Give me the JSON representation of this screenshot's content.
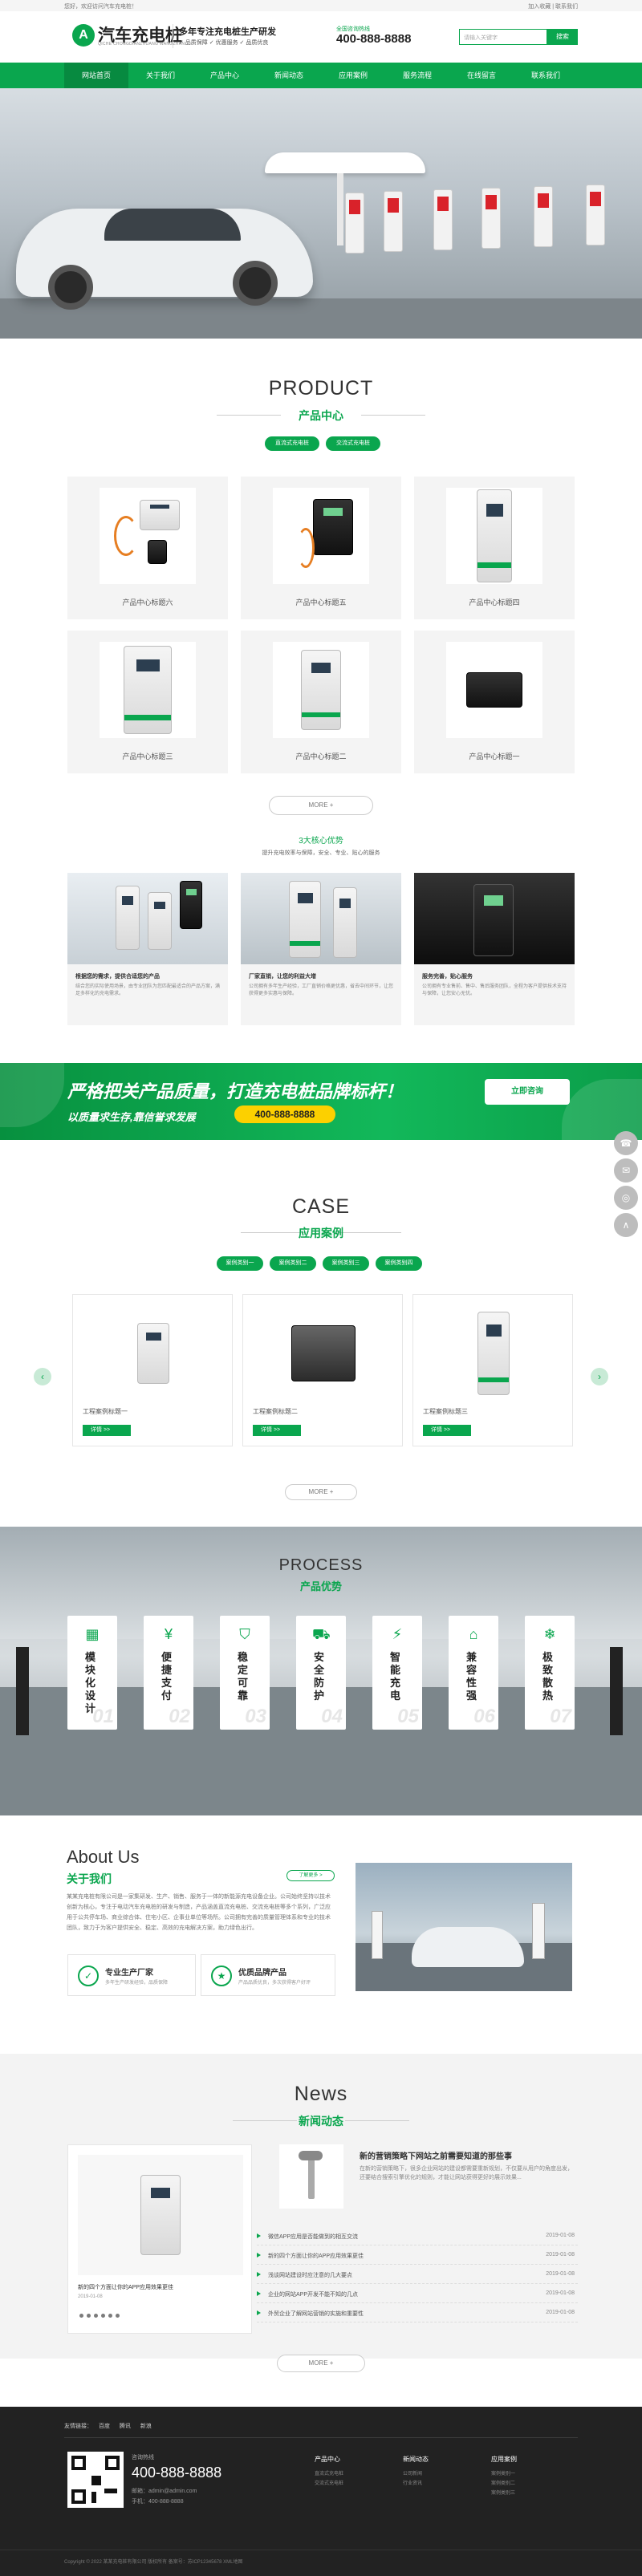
{
  "topbar": {
    "left": "您好，欢迎访问汽车充电桩！",
    "right": "加入收藏 | 联系我们"
  },
  "header": {
    "logo_mark": "A",
    "logo_title": "汽车充电桩",
    "logo_sub": "QICHE CHONGDIANZHUANG WANGZHAN",
    "slogan_main": "多年专注充电桩生产研发",
    "slogan_sub": "✓ 品质保障  ✓ 优惠服务  ✓ 品质优良",
    "hotline_label": "全国咨询热线",
    "hotline_number": "400-888-8888",
    "search_placeholder": "请输入关键字",
    "search_button": "搜索"
  },
  "nav": {
    "items": [
      "网站首页",
      "关于我们",
      "产品中心",
      "新闻动态",
      "应用案例",
      "服务流程",
      "在线留言",
      "联系我们"
    ]
  },
  "product": {
    "en": "PRODUCT",
    "cn": "产品中心",
    "tabs": [
      "直流式充电桩",
      "交流式充电桩"
    ],
    "items": [
      "产品中心标题六",
      "产品中心标题五",
      "产品中心标题四",
      "产品中心标题三",
      "产品中心标题二",
      "产品中心标题一"
    ],
    "more": "MORE +"
  },
  "advantages": {
    "title": "3大核心优势",
    "sub": "提升充电效率与保障，安全、专业、贴心的服务",
    "items": [
      {
        "title": "根据您的需求，提供合适您的产品",
        "text": "结合您的实际使用场景，由专业团队为您匹配最适合的产品方案，满足多样化的充电需求。"
      },
      {
        "title": "厂家直销，让您的利益大增",
        "text": "公司拥有多年生产经验，工厂直销价格更优惠，省去中间环节，让您获得更多实惠与保障。"
      },
      {
        "title": "服务完善，贴心服务",
        "text": "公司拥有专业售前、售中、售后服务团队，全程为客户提供技术支持与保障，让您安心无忧。"
      }
    ]
  },
  "promo": {
    "main": "严格把关产品质量，打造充电桩品牌标杆！",
    "sub": "以质量求生存,靠信誉求发展",
    "tel": "400-888-8888",
    "button": "立即咨询"
  },
  "floats": [
    "☎",
    "✉",
    "◎",
    "⚲",
    "∧"
  ],
  "case": {
    "en": "CASE",
    "cn": "应用案例",
    "tabs": [
      "案例类别一",
      "案例类别二",
      "案例类别三",
      "案例类别四"
    ],
    "items": [
      "工程案例标题一",
      "工程案例标题二",
      "工程案例标题三"
    ],
    "detail": "详情 >>",
    "more": "MORE +",
    "prev": "‹",
    "next": "›"
  },
  "process": {
    "en": "PROCESS",
    "cn": "产品优势",
    "items": [
      {
        "label": "模块化设计",
        "num": "01",
        "icon": "▦"
      },
      {
        "label": "便捷支付",
        "num": "02",
        "icon": "¥"
      },
      {
        "label": "稳定可靠",
        "num": "03",
        "icon": "⛉"
      },
      {
        "label": "安全防护",
        "num": "04",
        "icon": "⛟"
      },
      {
        "label": "智能充电",
        "num": "05",
        "icon": "⚡"
      },
      {
        "label": "兼容性强",
        "num": "06",
        "icon": "⌂"
      },
      {
        "label": "极致散热",
        "num": "07",
        "icon": "❄"
      }
    ]
  },
  "about": {
    "en": "About Us",
    "cn": "关于我们",
    "more": "了解更多 >",
    "text": "某某充电桩有限公司是一家集研发、生产、销售、服务于一体的新能源充电设备企业。公司始终坚持以技术创新为核心，专注于电动汽车充电桩的研发与制造，产品涵盖直流充电桩、交流充电桩等多个系列，广泛应用于公共停车场、商业综合体、住宅小区、企事业单位等场所。公司拥有完善的质量管理体系和专业的技术团队，致力于为客户提供安全、稳定、高效的充电解决方案，助力绿色出行。",
    "features": [
      {
        "title": "专业生产厂家",
        "desc": "多年生产研发经验，品质保障",
        "icon": "✓"
      },
      {
        "title": "优质品牌产品",
        "desc": "产品品质优良，多次获得客户好评",
        "icon": "★"
      }
    ]
  },
  "news": {
    "en": "News",
    "cn": "新闻动态",
    "left_title": "新的四个方面让你的APP应用效果更佳",
    "left_date": "2019-01-08",
    "feature_title": "新的营销策略下网站之前需要知道的那些事",
    "feature_text": "在新的营销策略下，很多企业网站的建设都需要重新规划，不仅要从用户的角度出发，还要结合搜索引擎优化的规则，才能让网站获得更好的展示效果...",
    "rows": [
      {
        "title": "微信APP应用是否能做到的相互交流",
        "date": "2019-01-08"
      },
      {
        "title": "新的四个方面让你的APP应用效果更佳",
        "date": "2019-01-08"
      },
      {
        "title": "浅谈网站建设时应注意的几大要点",
        "date": "2019-01-08"
      },
      {
        "title": "企业的网站APP开发不能不知的几点",
        "date": "2019-01-08"
      },
      {
        "title": "外贸企业了解网站营销的实施和重要性",
        "date": "2019-01-08"
      }
    ],
    "more": "MORE +"
  },
  "footer": {
    "links_label": "友情链接：",
    "links": [
      "百度",
      "腾讯",
      "新浪"
    ],
    "hotline_label": "咨询热线",
    "tel": "400-888-8888",
    "email": "邮箱：admin@admin.com",
    "phone": "手机：400-888-8888",
    "columns": [
      {
        "title": "产品中心",
        "items": [
          "直流式充电桩",
          "交流式充电桩"
        ]
      },
      {
        "title": "新闻动态",
        "items": [
          "公司新闻",
          "行业资讯"
        ]
      },
      {
        "title": "应用案例",
        "items": [
          "案例类别一",
          "案例类别二",
          "案例类别三"
        ]
      }
    ],
    "copyright": "Copyright © 2022 某某充电桩有限公司 版权所有 备案号：苏ICP12345678 XML地图"
  },
  "colors": {
    "brand": "#0aa64e",
    "accent": "#fcd000",
    "footer": "#222222"
  }
}
